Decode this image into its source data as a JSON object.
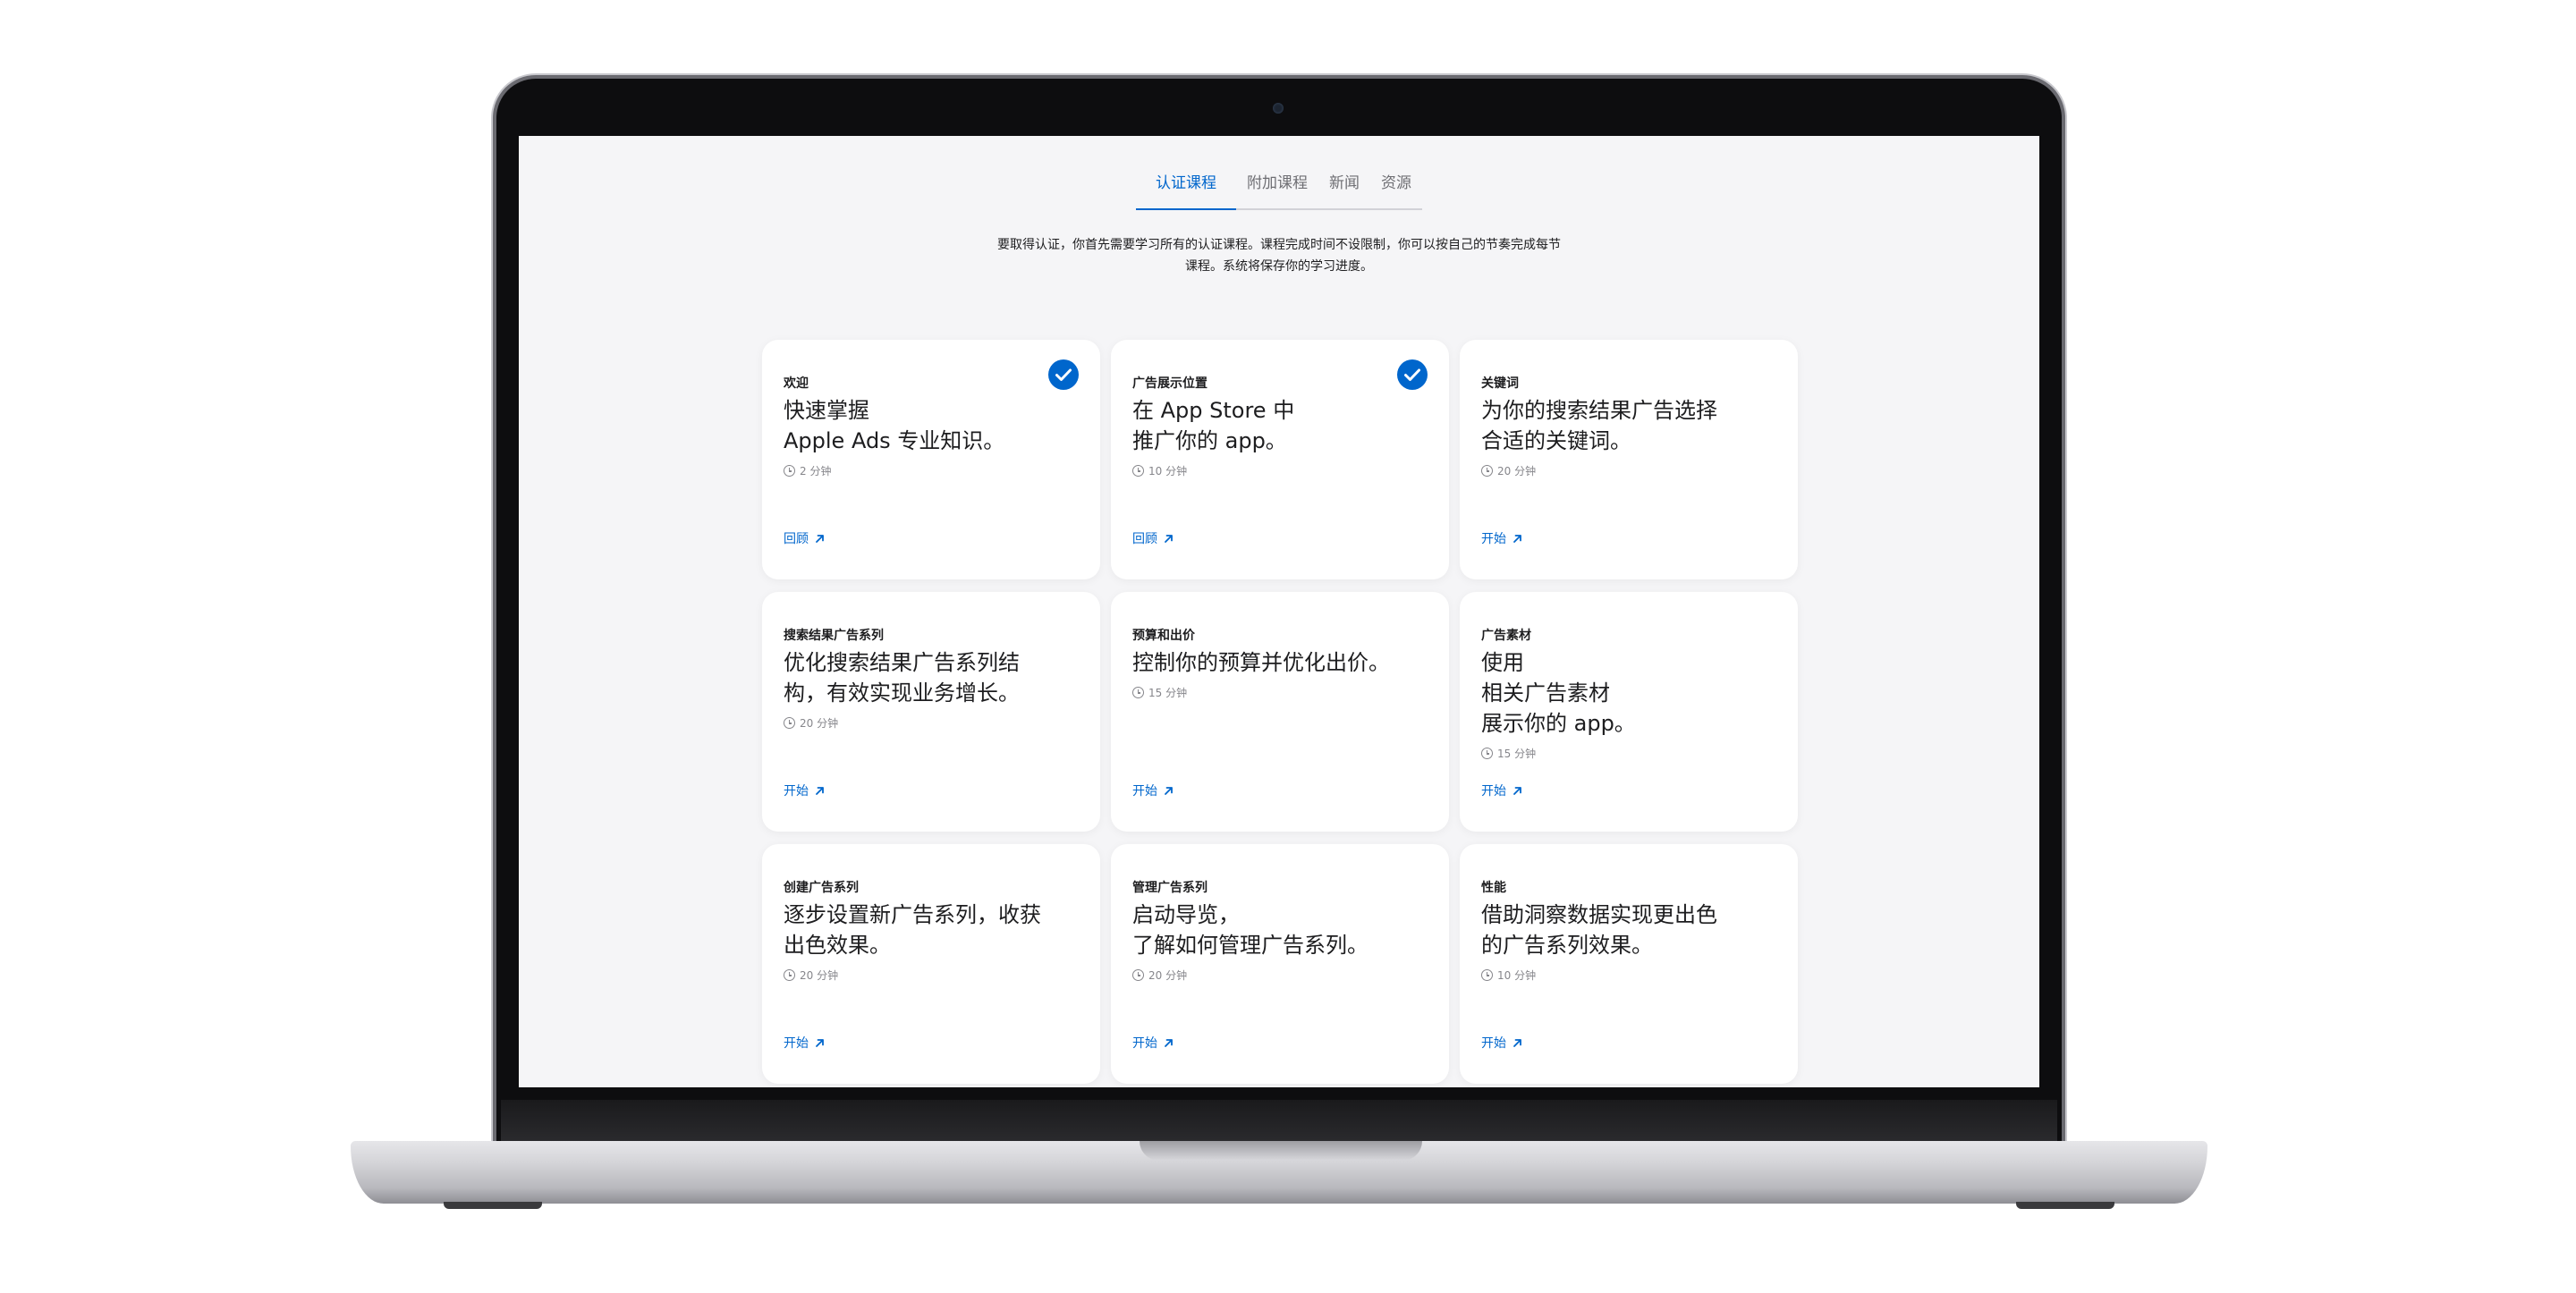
{
  "tabs": [
    {
      "label": "认证课程",
      "active": true
    },
    {
      "label": "附加课程",
      "active": false
    },
    {
      "label": "新闻",
      "active": false
    },
    {
      "label": "资源",
      "active": false
    }
  ],
  "intro": {
    "line1": "要取得认证，你首先需要学习所有的认证课程。课程完成时间不设限制，你可以按自己的节奏完成每节",
    "line2": "课程。系统将保存你的学习进度。"
  },
  "colors": {
    "accent": "#0066cc",
    "background": "#f5f5f7",
    "card": "#ffffff"
  },
  "cards": [
    {
      "category": "欢迎",
      "title": "快速掌握\nApple Ads 专业知识。",
      "duration": "2 分钟",
      "action": "回顾",
      "completed": true
    },
    {
      "category": "广告展示位置",
      "title": "在 App Store 中\n推广你的 app。",
      "duration": "10 分钟",
      "action": "回顾",
      "completed": true
    },
    {
      "category": "关键词",
      "title": "为你的搜索结果广告选择\n合适的关键词。",
      "duration": "20 分钟",
      "action": "开始",
      "completed": false
    },
    {
      "category": "搜索结果广告系列",
      "title": "优化搜索结果广告系列结\n构，有效实现业务增长。",
      "duration": "20 分钟",
      "action": "开始",
      "completed": false
    },
    {
      "category": "预算和出价",
      "title": "控制你的预算并优化出价。",
      "duration": "15 分钟",
      "action": "开始",
      "completed": false
    },
    {
      "category": "广告素材",
      "title": "使用\n相关广告素材\n展示你的 app。",
      "duration": "15 分钟",
      "action": "开始",
      "completed": false
    },
    {
      "category": "创建广告系列",
      "title": "逐步设置新广告系列，收获\n出色效果。",
      "duration": "20 分钟",
      "action": "开始",
      "completed": false
    },
    {
      "category": "管理广告系列",
      "title": "启动导览，\n了解如何管理广告系列。",
      "duration": "20 分钟",
      "action": "开始",
      "completed": false
    },
    {
      "category": "性能",
      "title": "借助洞察数据实现更出色\n的广告系列效果。",
      "duration": "10 分钟",
      "action": "开始",
      "completed": false
    }
  ],
  "icons": {
    "completed": "checkmark-circle-icon",
    "duration": "clock-icon",
    "action": "arrow-up-right-icon"
  }
}
